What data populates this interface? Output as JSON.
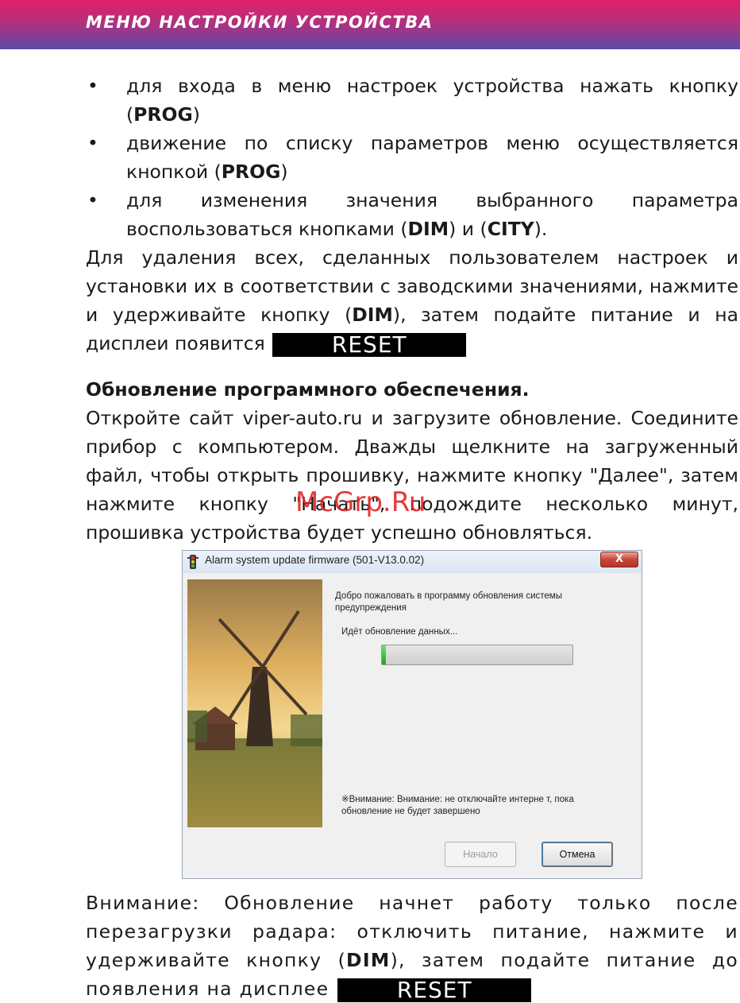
{
  "header": {
    "title": "МЕНЮ НАСТРОЙКИ УСТРОЙСТВА"
  },
  "bullets": [
    {
      "text": "для входа в меню настроек устройства нажать кнопку (",
      "key": "PROG",
      "tail": ")"
    },
    {
      "text": "движение по списку параметров меню осуществляется кнопкой (",
      "key": "PROG",
      "tail": ")"
    },
    {
      "text": "для изменения значения выбранного параметра воспользоваться кнопками (",
      "key": "DIM",
      "mid": ") и (",
      "key2": "CITY",
      "tail": ")."
    }
  ],
  "reset_para": {
    "text1": "Для удаления всех, сделанных пользователем настроек и установки их в соответствии с заводскими значениями, нажмите и удерживайте кнопку (",
    "key": "DIM",
    "text2": "), затем подайте питание и на дисплеи появится",
    "display": "RESET"
  },
  "update_section": {
    "title": "Обновление программного обеспечения.",
    "text": "Откройте сайт viper-auto.ru и загрузите обновление. Соедините прибор с компьютером. Дважды щелкните на загруженный файл, чтобы открыть прошивку, нажмите кнопку \"Далее\", затем нажмите кнопку \"Начать\", подождите несколько минут, прошивка устройства будет успешно обновляться."
  },
  "watermark": "McGrp.Ru",
  "dialog": {
    "title": "Alarm system update firmware (501-V13.0.02)",
    "close_label": "X",
    "welcome": "Добро пожаловать в программу обновления системы предупреждения",
    "status": "Идёт обновление данных...",
    "progress": 0.02,
    "warning": "※Внимание: Внимание: не отключайте интерне т, пока обновление не будет завершено",
    "start_label": "Начало",
    "cancel_label": "Отмена"
  },
  "bottom_para": {
    "text1": "Внимание: Обновление начнет работу только после перезагрузки радара: отключить питание,  нажмите и удерживайте кнопку (",
    "key": "DIM",
    "text2": "), затем подайте питание до появления на дисплее",
    "display": "RESET"
  }
}
